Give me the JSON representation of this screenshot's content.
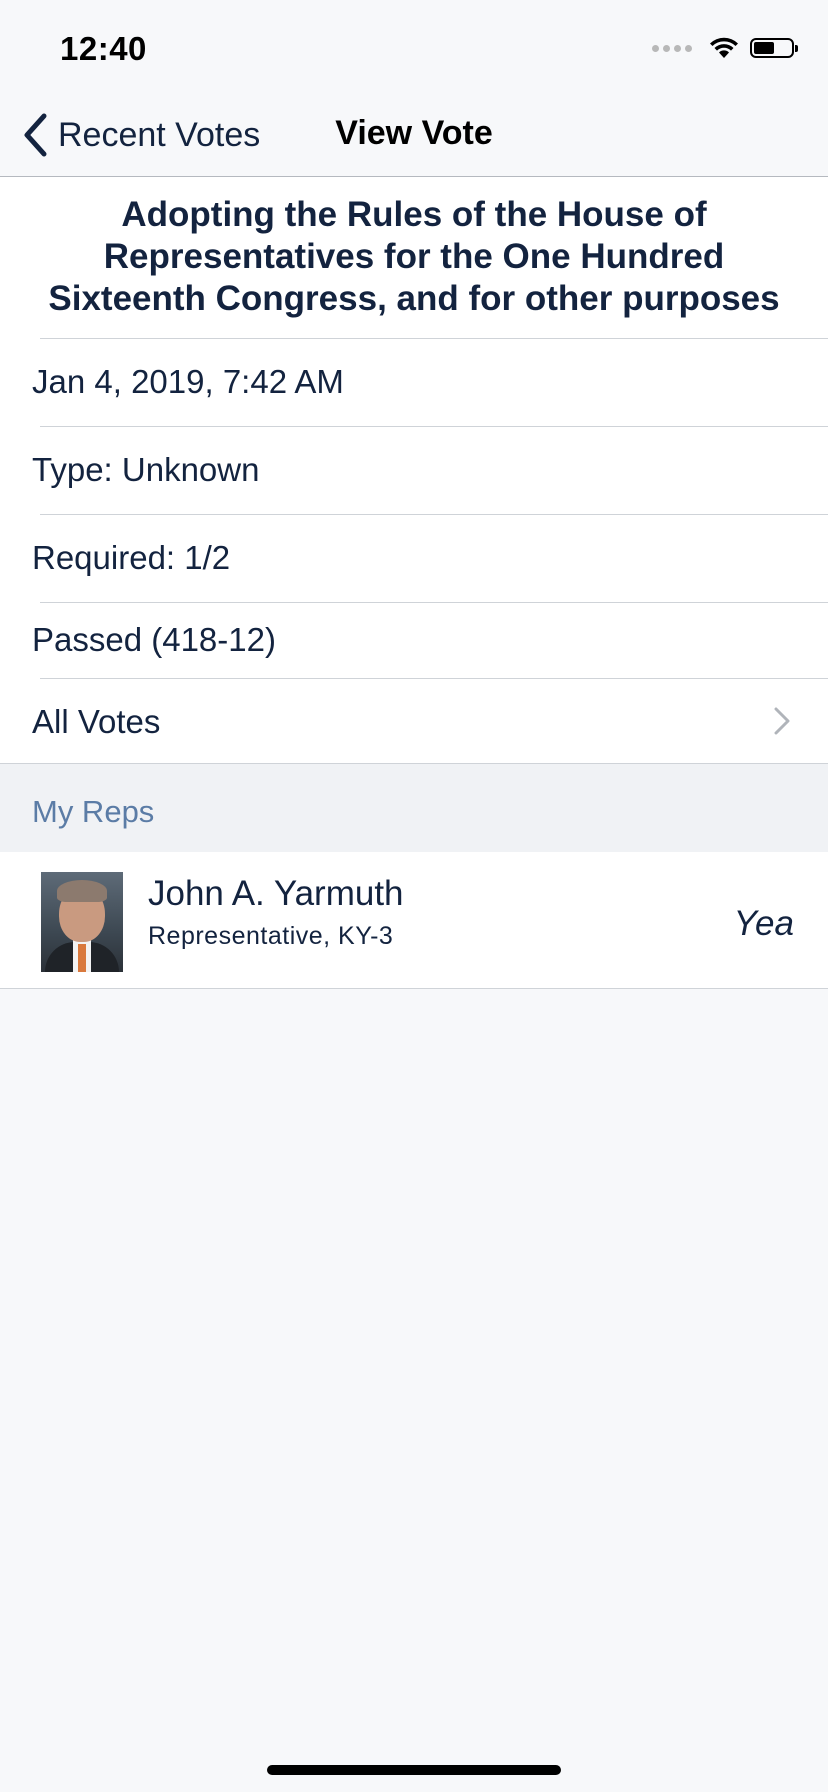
{
  "status_bar": {
    "time": "12:40"
  },
  "nav": {
    "back_label": "Recent Votes",
    "title": "View Vote"
  },
  "vote": {
    "title": "Adopting the Rules of the House of Representatives for the One Hundred Sixteenth Congress, and for other purposes",
    "date": "Jan 4, 2019, 7:42 AM",
    "type": "Type: Unknown",
    "required": "Required: 1/2",
    "result": "Passed (418-12)",
    "all_votes_label": "All Votes"
  },
  "my_reps": {
    "section_label": "My Reps",
    "reps": [
      {
        "name": "John A. Yarmuth",
        "role": "Representative, KY-3",
        "vote": "Yea"
      }
    ]
  },
  "colors": {
    "text": "#13233f",
    "section_label": "#5b7ca6",
    "background": "#f7f8fa"
  }
}
